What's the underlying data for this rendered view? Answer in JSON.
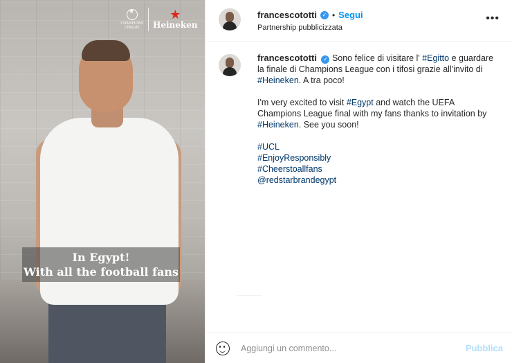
{
  "media": {
    "brand_ucl_text": "CHAMPIONS LEAGUE",
    "brand_heineken_text": "Heineken",
    "caption_line1": "In Egypt!",
    "caption_line2": "With all the football fans"
  },
  "header": {
    "username": "francescototti",
    "separator": "•",
    "follow_label": "Segui",
    "partnership_label": "Partnership pubblicizzata",
    "more_label": "•••"
  },
  "post": {
    "username": "francescototti",
    "it_before": "Sono felice di visitare l' ",
    "it_tag": "#Egitto",
    "it_middle": " e guardare la finale di Champions League con i tifosi grazie all'invito di ",
    "it_tag2": "#Heineken",
    "it_after": ". A tra poco!",
    "en_before": "I'm very excited to visit ",
    "en_tag": "#Egypt",
    "en_middle": " and watch the UEFA Champions League final with my fans thanks to invitation by ",
    "en_tag2": "#Heineken",
    "en_after": ". See you soon!",
    "hashtags": [
      "#UCL",
      "#EnjoyResponsibly",
      "#Cheerstoallfans",
      "@redstarbrandegypt"
    ]
  },
  "comment_bar": {
    "placeholder": "Aggiungi un commento...",
    "publish_label": "Pubblica"
  },
  "colors": {
    "accent": "#0095f6",
    "link": "#00376b",
    "verified": "#3897f0",
    "heineken_red": "#e1261c"
  },
  "icons": [
    "chevron-star-icon",
    "verified-badge-icon",
    "more-options-icon",
    "emoji-icon"
  ]
}
